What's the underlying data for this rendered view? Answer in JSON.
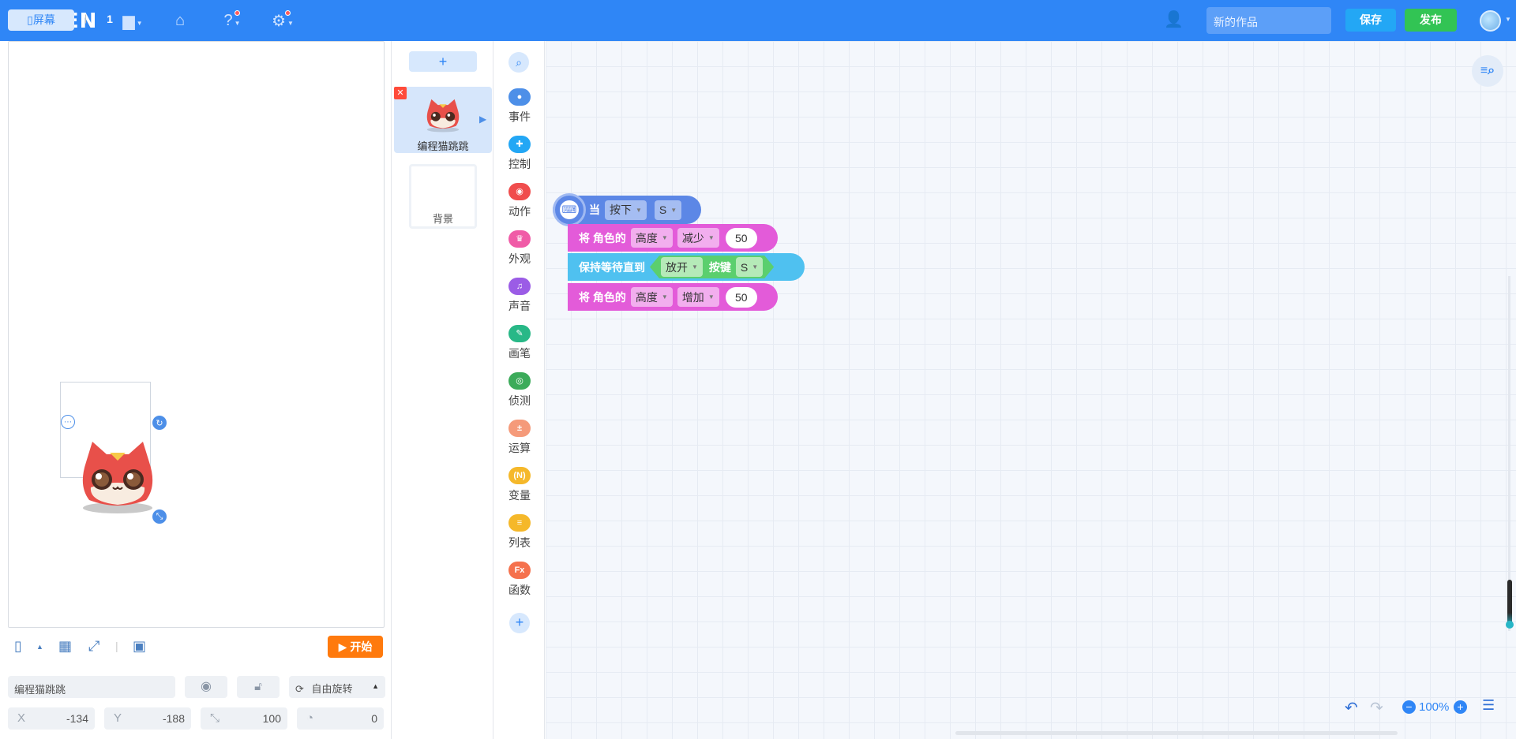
{
  "topbar": {
    "logo": "KITTEN",
    "project_name": "新的作品",
    "save_label": "保存",
    "publish_label": "发布"
  },
  "stage": {
    "screen_label": "屏幕",
    "screen_number": "1",
    "start_label": "开始",
    "sprite_name": "编程猫跳跳",
    "rotation_mode": "自由旋转",
    "x_label": "X",
    "x_value": "-134",
    "y_label": "Y",
    "y_value": "-188",
    "size_value": "100",
    "rotation_value": "0"
  },
  "sprites": {
    "add_label": "+",
    "items": [
      {
        "label": "编程猫跳跳"
      }
    ],
    "background_label": "背景"
  },
  "categories": [
    {
      "label": "事件",
      "color": "#4d8fe8",
      "glyph": "●"
    },
    {
      "label": "控制",
      "color": "#23a7f5",
      "glyph": "✚"
    },
    {
      "label": "动作",
      "color": "#f04d4d",
      "glyph": "◉"
    },
    {
      "label": "外观",
      "color": "#f05ba7",
      "glyph": "♛"
    },
    {
      "label": "声音",
      "color": "#9b5ce6",
      "glyph": "♫"
    },
    {
      "label": "画笔",
      "color": "#28b887",
      "glyph": "✎"
    },
    {
      "label": "侦测",
      "color": "#3cab5a",
      "glyph": "◎"
    },
    {
      "label": "运算",
      "color": "#f59a7a",
      "glyph": "±"
    },
    {
      "label": "变量",
      "color": "#f5b82a",
      "glyph": "(N)"
    },
    {
      "label": "列表",
      "color": "#f5b82a",
      "glyph": "≡"
    },
    {
      "label": "函数",
      "color": "#f5714d",
      "glyph": "Fx"
    }
  ],
  "blocks": {
    "hat": {
      "prefix": "当",
      "event": "按下",
      "key": "S"
    },
    "b1": {
      "text": "将 角色的",
      "prop": "高度",
      "op": "减少",
      "num": "50"
    },
    "b2": {
      "text": "保持等待直到",
      "state": "放开",
      "mid": "按键",
      "key": "S"
    },
    "b3": {
      "text": "将 角色的",
      "prop": "高度",
      "op": "增加",
      "num": "50"
    }
  },
  "workspace": {
    "zoom": "100%"
  },
  "colors": {
    "brand": "#2f86f6",
    "save": "#23a7f5",
    "publish": "#32c454",
    "start": "#ff7a0d",
    "event_block": "#5c87e6",
    "appearance_block": "#e35bd9",
    "control_block": "#4fc1f0"
  }
}
